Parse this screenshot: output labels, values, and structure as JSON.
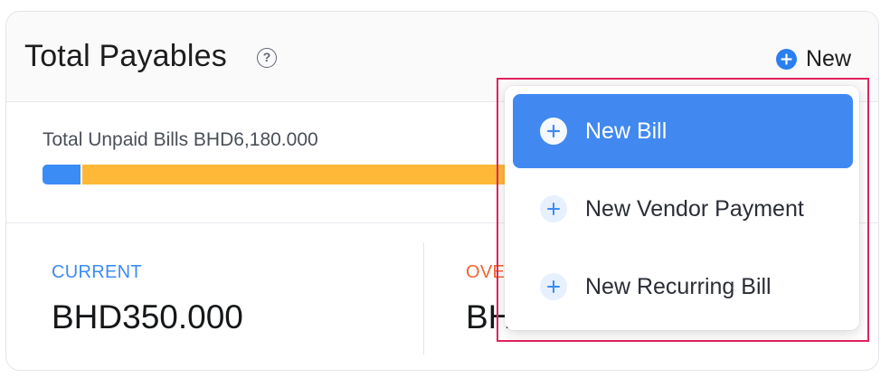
{
  "card": {
    "title": "Total Payables",
    "new_label": "New",
    "unpaid_label": "Total Unpaid Bills BHD6,180.000",
    "progress": {
      "paid_fraction": 0.08
    },
    "current_label": "CURRENT",
    "current_value": "BHD350.000",
    "overdue_label": "OVE",
    "overdue_value": "BH"
  },
  "dropdown": {
    "items": [
      {
        "label": "New Bill",
        "active": true
      },
      {
        "label": "New Vendor Payment",
        "active": false
      },
      {
        "label": "New Recurring Bill",
        "active": false
      }
    ]
  },
  "colors": {
    "accent": "#4189f0",
    "progress_blue": "#3b8cf4",
    "progress_orange": "#ffb838",
    "overdue": "#f0662f",
    "highlight_border": "#e0245e"
  }
}
